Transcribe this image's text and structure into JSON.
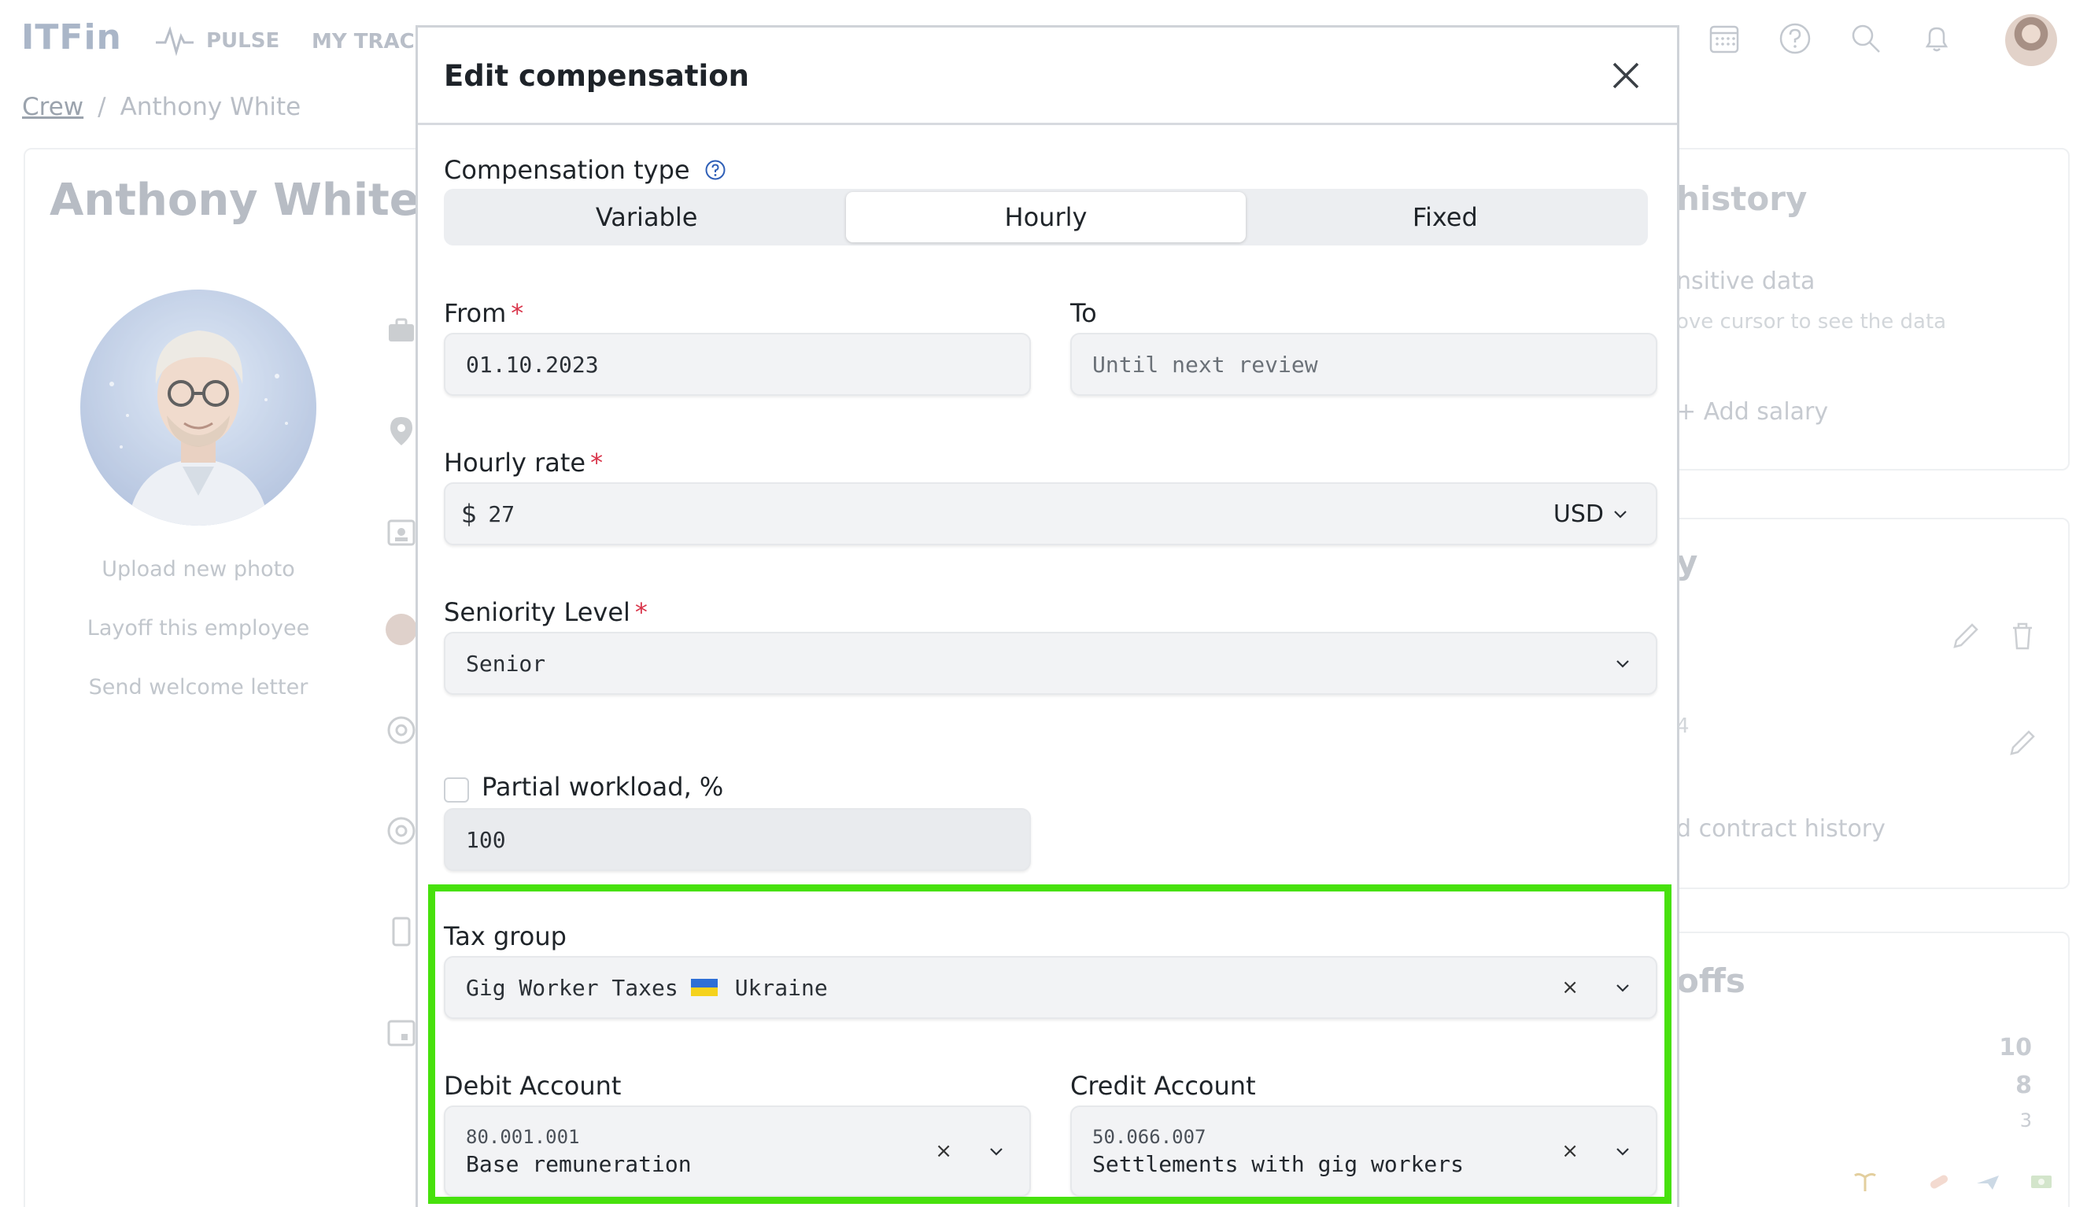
{
  "app": {
    "logo": "ITFin",
    "nav": {
      "pulse": "PULSE",
      "tracker": "MY TRACKE"
    }
  },
  "breadcrumb": {
    "root": "Crew",
    "separator": "/",
    "current": "Anthony White"
  },
  "employee": {
    "name": "Anthony White",
    "actions": {
      "upload_photo": "Upload new photo",
      "layoff": "Layoff this employee",
      "welcome_letter": "Send welcome letter"
    }
  },
  "right_panel": {
    "history_title": "history",
    "sensitive_data": "nsitive data",
    "sensitive_hint": "ove cursor to see the data",
    "add_salary": "Add salary",
    "section2_title": "y",
    "contract_history": "d contract history",
    "dayoffs_title": "offs",
    "counts": [
      "10",
      "8",
      "3"
    ],
    "small_value": "4"
  },
  "modal": {
    "title": "Edit compensation",
    "compensation_type": {
      "label": "Compensation type",
      "options": [
        "Variable",
        "Hourly",
        "Fixed"
      ],
      "selected": "Hourly"
    },
    "from": {
      "label": "From",
      "value": "01.10.2023"
    },
    "to": {
      "label": "To",
      "placeholder": "Until next review"
    },
    "hourly_rate": {
      "label": "Hourly rate",
      "prefix": "$",
      "value": "27",
      "currency": "USD"
    },
    "seniority": {
      "label": "Seniority Level",
      "value": "Senior"
    },
    "partial_workload": {
      "label": "Partial workload, %",
      "value": "100",
      "checked": false
    },
    "tax_group": {
      "label": "Tax group",
      "value": "Gig Worker Taxes",
      "country": "Ukraine"
    },
    "debit_account": {
      "label": "Debit Account",
      "code": "80.001.001",
      "name": "Base remuneration"
    },
    "credit_account": {
      "label": "Credit Account",
      "code": "50.066.007",
      "name": "Settlements with gig workers"
    },
    "required_mark": "*",
    "clear_glyph": "×"
  },
  "colors": {
    "highlight": "#47e10c",
    "required": "#d9344a",
    "flag_blue": "#2f6fd6",
    "flag_yellow": "#f5d21d"
  }
}
